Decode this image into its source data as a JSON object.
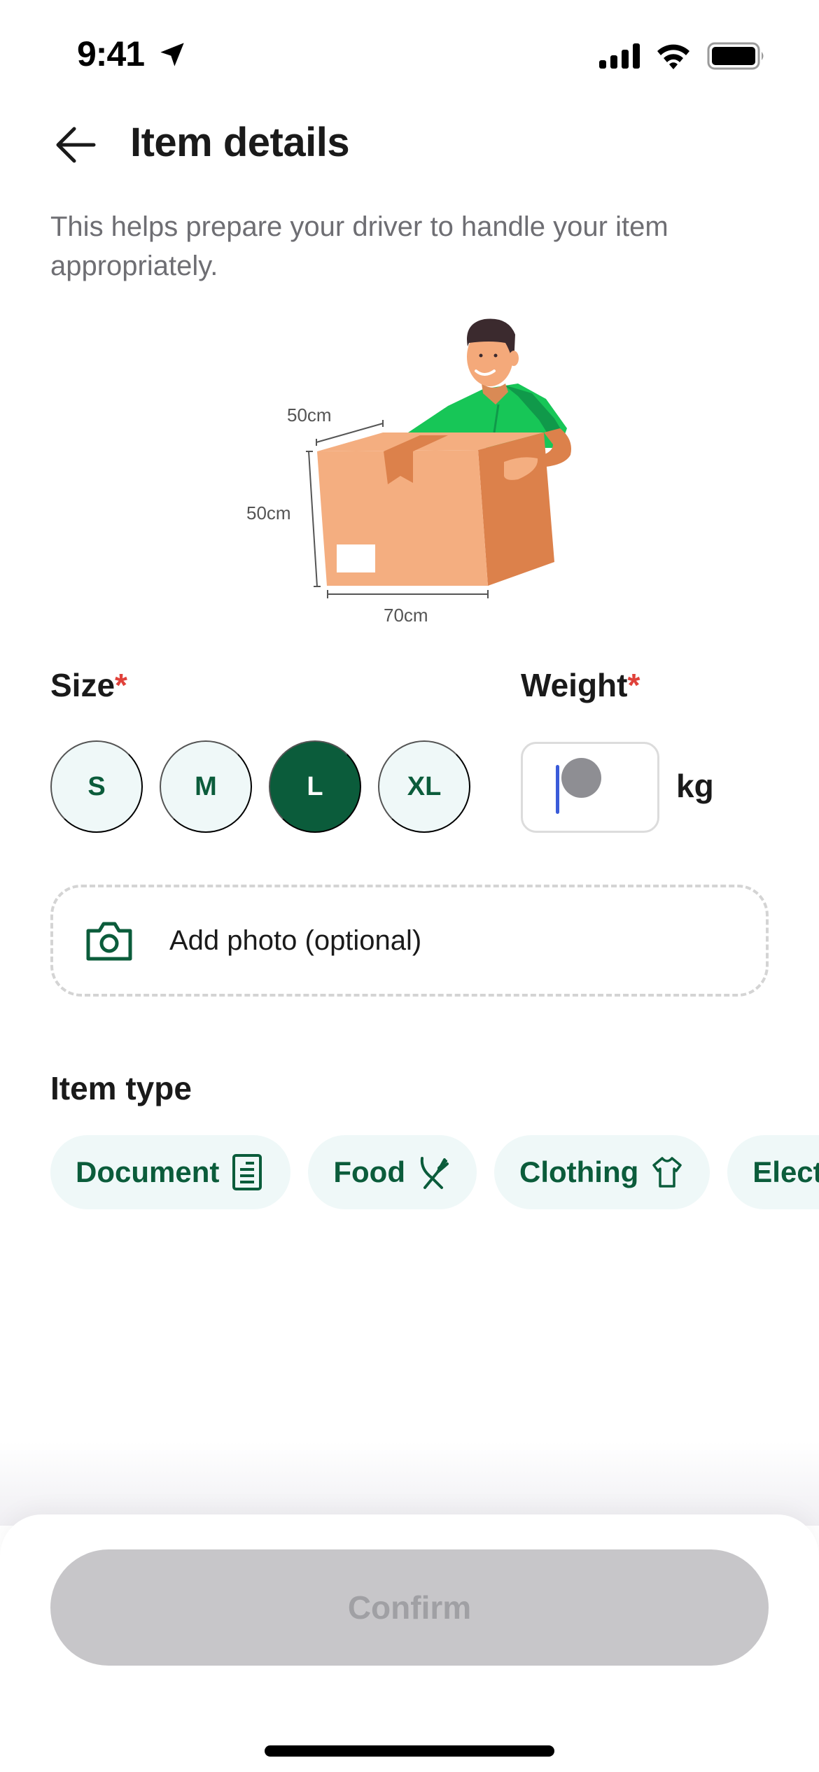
{
  "status_bar": {
    "time": "9:41"
  },
  "header": {
    "title": "Item details",
    "back_icon": "arrow-left-icon"
  },
  "subtitle": "This helps prepare your driver to handle your item appropriately.",
  "illustration": {
    "dimensions": {
      "depth": "50cm",
      "height": "50cm",
      "width": "70cm"
    }
  },
  "size": {
    "label": "Size",
    "required_mark": "*",
    "options": [
      "S",
      "M",
      "L",
      "XL"
    ],
    "selected": "L"
  },
  "weight": {
    "label": "Weight",
    "required_mark": "*",
    "value": "",
    "unit": "kg"
  },
  "add_photo": {
    "label": "Add photo (optional)",
    "icon": "camera-icon"
  },
  "item_type": {
    "label": "Item type",
    "options": [
      {
        "label": "Document",
        "icon": "document-icon"
      },
      {
        "label": "Food",
        "icon": "utensils-icon"
      },
      {
        "label": "Clothing",
        "icon": "tshirt-icon"
      },
      {
        "label": "Electronics",
        "icon": "electronics-icon"
      }
    ]
  },
  "footer": {
    "confirm_label": "Confirm"
  },
  "colors": {
    "accent": "#0b5c3b",
    "chip_bg": "#eff8f8",
    "required": "#e0413a",
    "disabled_button": "#c7c6c9",
    "disabled_text": "#a0a0a4",
    "caret": "#3a5bd9"
  }
}
